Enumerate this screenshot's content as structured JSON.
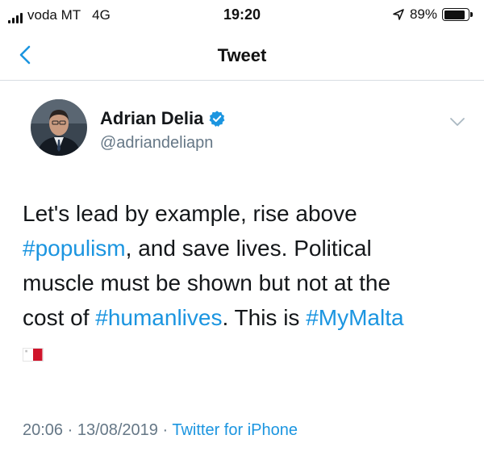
{
  "status_bar": {
    "carrier": "voda MT",
    "network": "4G",
    "time": "19:20",
    "battery": "89%",
    "battery_level": 0.89
  },
  "nav": {
    "back_icon": "chevron-left-icon",
    "title": "Tweet"
  },
  "tweet": {
    "author": {
      "name": "Adrian Delia",
      "handle": "@adriandeliapn",
      "verified_icon": "verified-badge-icon"
    },
    "menu_icon": "chevron-down-icon",
    "text": {
      "line1": "Let's lead by example, rise above",
      "hashtag_populism": "#populism",
      "line2_rest": ", and save lives. Political",
      "line3": "muscle must be shown but not at the",
      "line4_start": "cost of ",
      "hashtag_humanlives": "#humanlives",
      "line4_mid": ". This is ",
      "hashtag_mymalta": "#MyMalta",
      "emoji_icon": "malta-flag-icon"
    },
    "timestamp": "20:06 · 13/08/2019",
    "separator": " · ",
    "source": "Twitter for iPhone"
  },
  "colors": {
    "link": "#1b95e0",
    "secondary_text": "#657786",
    "primary_text": "#14171a",
    "divider": "#d8dde2"
  }
}
